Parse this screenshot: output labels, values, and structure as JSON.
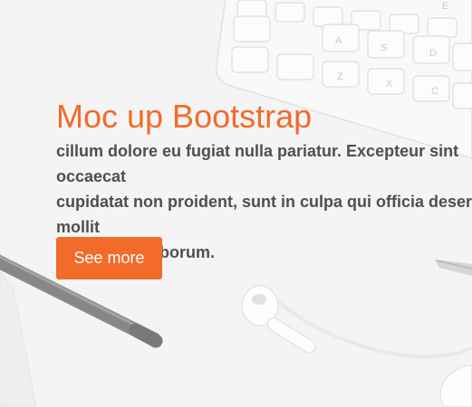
{
  "hero": {
    "title": "Moc up Bootstrap",
    "text": "cillum dolore eu fugiat nulla pariatur. Excepteur sint occaecat\ncupidatat non proident, sunt in culpa qui officia deserunt mollit\nanim id est laborum.",
    "button_label": "See more",
    "background_icons": [
      "keyboard-icon",
      "pen-icon",
      "earphones-icon",
      "notebook-icon"
    ]
  },
  "colors": {
    "accent": "#f26b2a",
    "text": "#4f4f4f",
    "background": "#f1f1f1"
  }
}
